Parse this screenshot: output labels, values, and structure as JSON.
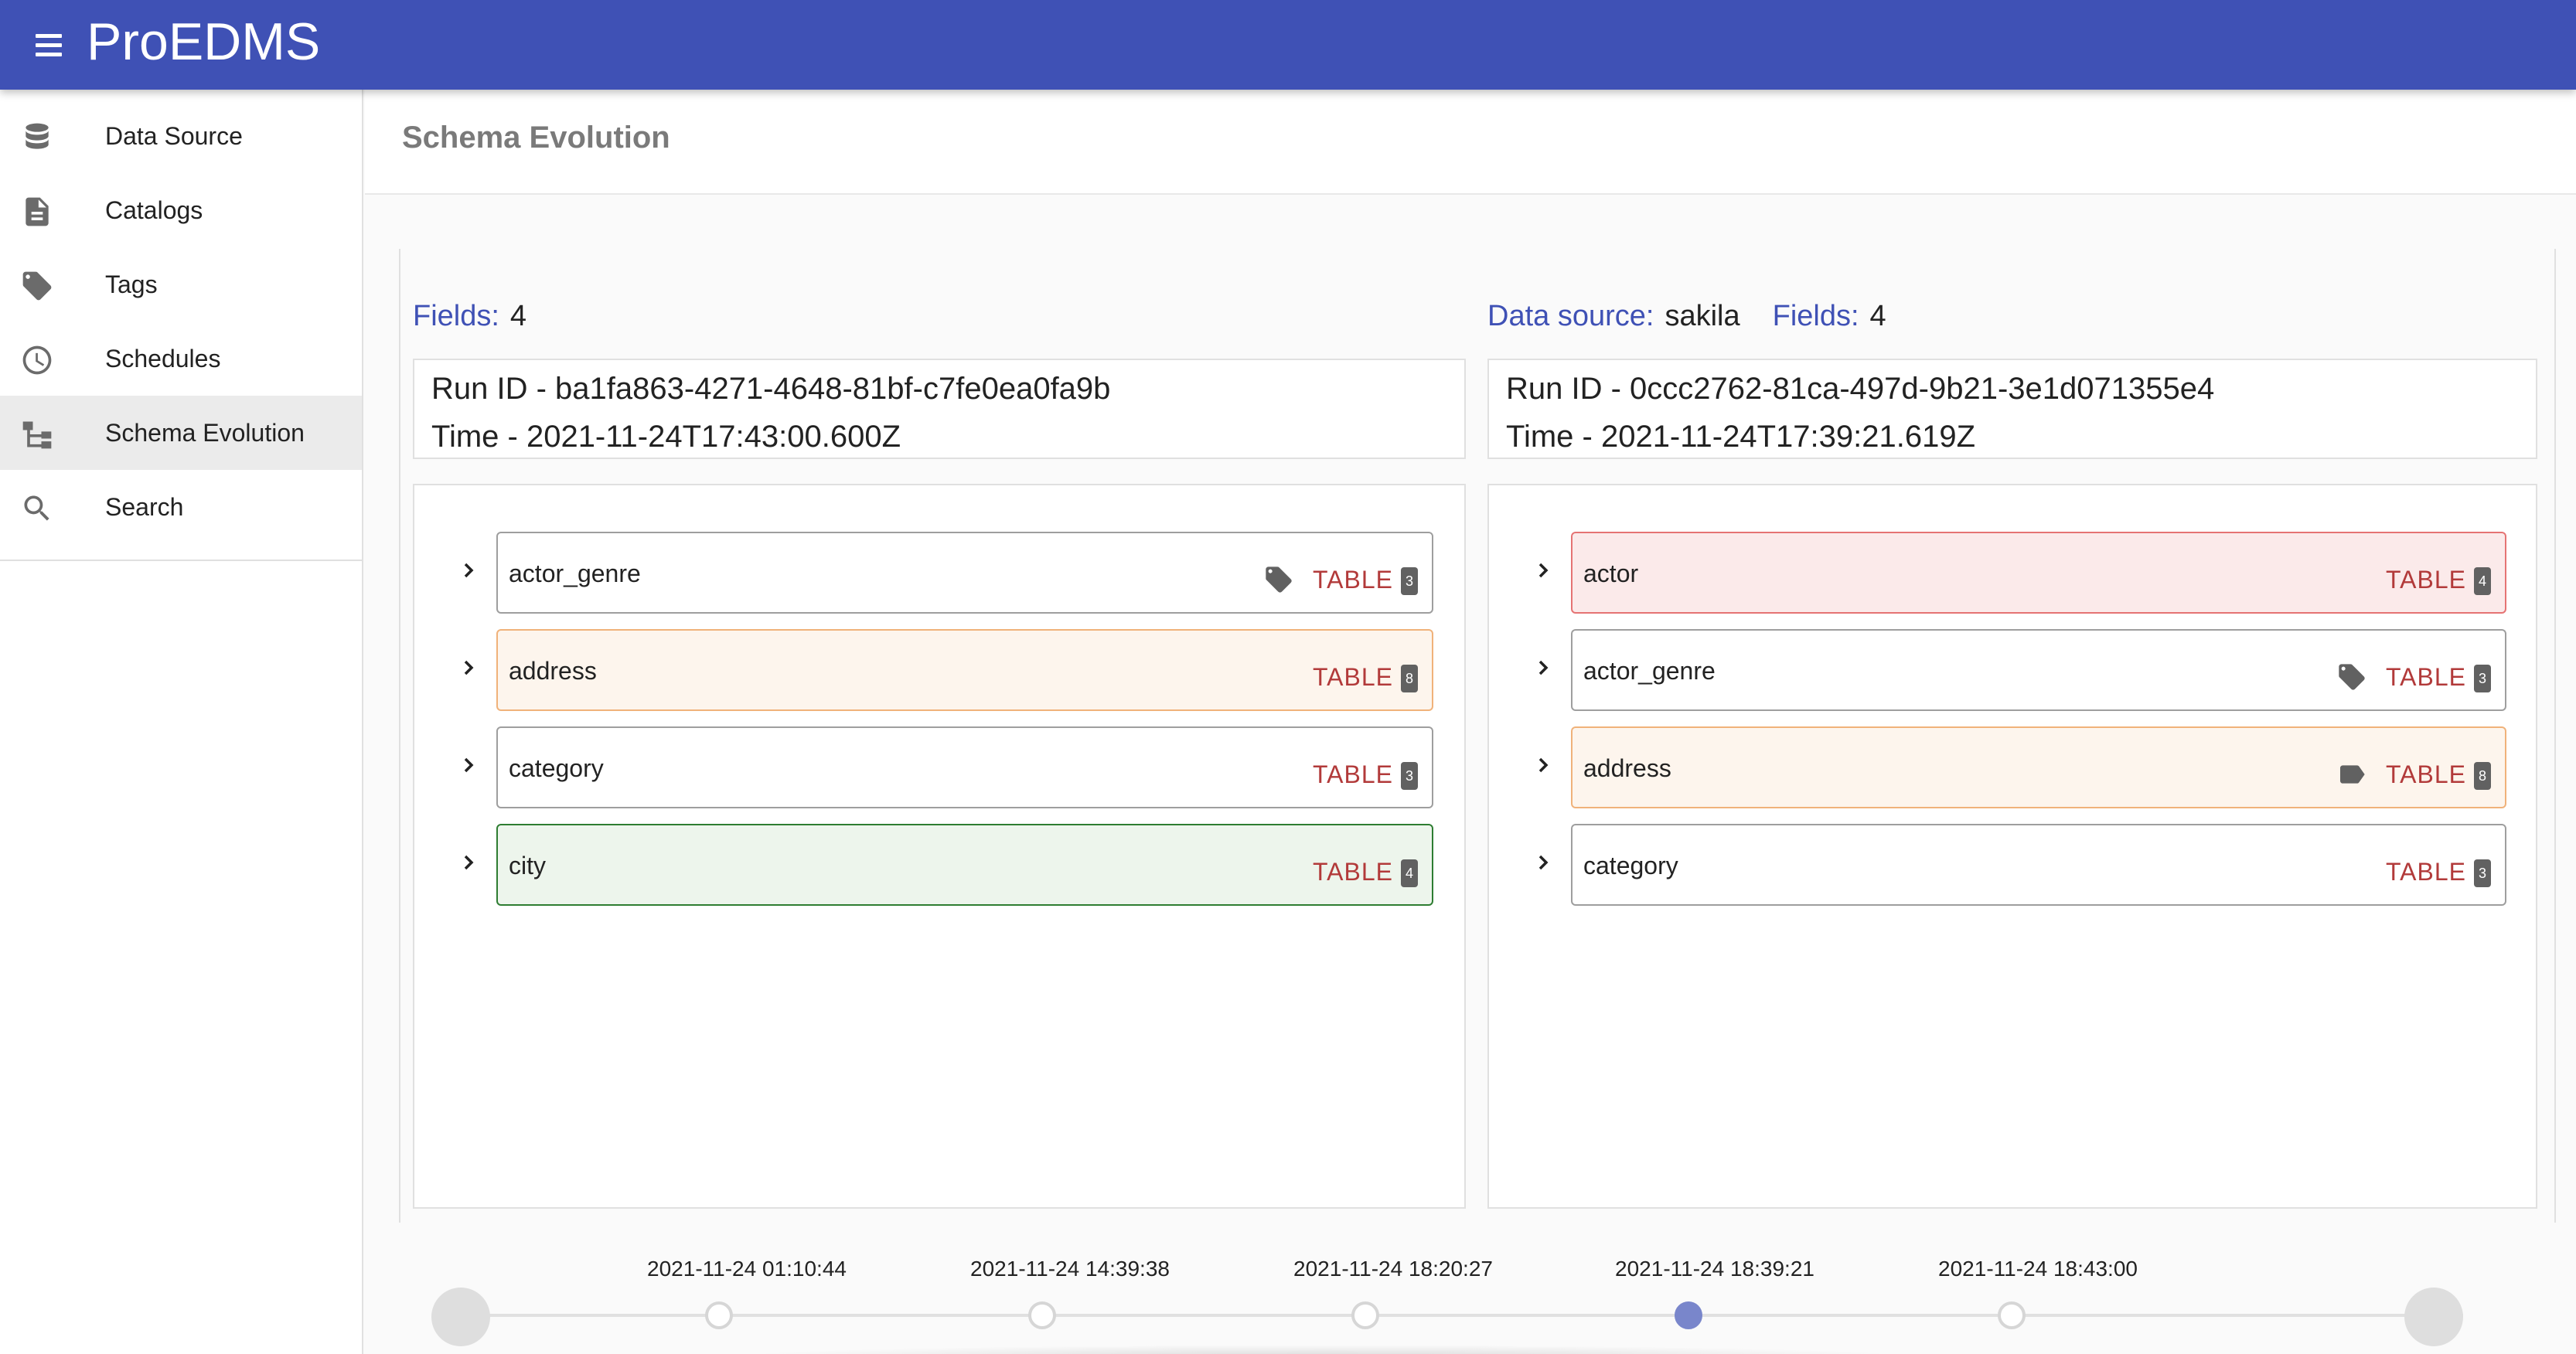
{
  "app": {
    "title": "ProEDMS"
  },
  "sidebar": {
    "items": [
      {
        "label": "Data Source",
        "icon": "database-icon",
        "active": false
      },
      {
        "label": "Catalogs",
        "icon": "document-icon",
        "active": false
      },
      {
        "label": "Tags",
        "icon": "tag-icon",
        "active": false
      },
      {
        "label": "Schedules",
        "icon": "clock-icon",
        "active": false
      },
      {
        "label": "Schema Evolution",
        "icon": "schema-tree-icon",
        "active": true
      },
      {
        "label": "Search",
        "icon": "search-icon",
        "active": false
      }
    ]
  },
  "page": {
    "title": "Schema Evolution"
  },
  "left": {
    "fields_label": "Fields:",
    "fields_value": "4",
    "run_id": "Run ID - ba1fa863-4271-4648-81bf-c7fe0ea0fa9b",
    "time": "Time - 2021-11-24T17:43:00.600Z",
    "nodes": [
      {
        "name": "actor_genre",
        "type": "TABLE",
        "count": "3",
        "status": "unchanged",
        "tag": "filled"
      },
      {
        "name": "address",
        "type": "TABLE",
        "count": "8",
        "status": "modified",
        "tag": "none"
      },
      {
        "name": "category",
        "type": "TABLE",
        "count": "3",
        "status": "unchanged",
        "tag": "none"
      },
      {
        "name": "city",
        "type": "TABLE",
        "count": "4",
        "status": "added",
        "tag": "none"
      }
    ]
  },
  "right": {
    "datasource_label": "Data source:",
    "datasource_value": "sakila",
    "fields_label": "Fields:",
    "fields_value": "4",
    "run_id": "Run ID - 0ccc2762-81ca-497d-9b21-3e1d071355e4",
    "time": "Time - 2021-11-24T17:39:21.619Z",
    "nodes": [
      {
        "name": "actor",
        "type": "TABLE",
        "count": "4",
        "status": "removed",
        "tag": "none"
      },
      {
        "name": "actor_genre",
        "type": "TABLE",
        "count": "3",
        "status": "unchanged",
        "tag": "filled"
      },
      {
        "name": "address",
        "type": "TABLE",
        "count": "8",
        "status": "modified",
        "tag": "label"
      },
      {
        "name": "category",
        "type": "TABLE",
        "count": "3",
        "status": "unchanged",
        "tag": "none"
      }
    ]
  },
  "timeline": {
    "points": [
      {
        "label": "2021-11-24 01:10:44",
        "active": false
      },
      {
        "label": "2021-11-24 14:39:38",
        "active": false
      },
      {
        "label": "2021-11-24 18:20:27",
        "active": false
      },
      {
        "label": "2021-11-24 18:39:21",
        "active": true
      },
      {
        "label": "2021-11-24 18:43:00",
        "active": false
      }
    ]
  },
  "colors": {
    "appbar": "#3f51b5",
    "accent_text": "#3f51b5",
    "type_text": "#b23a3a",
    "added": "#2e7d32",
    "modified": "#f0b27a",
    "removed": "#e57373",
    "timeline_active": "#7986cb"
  }
}
